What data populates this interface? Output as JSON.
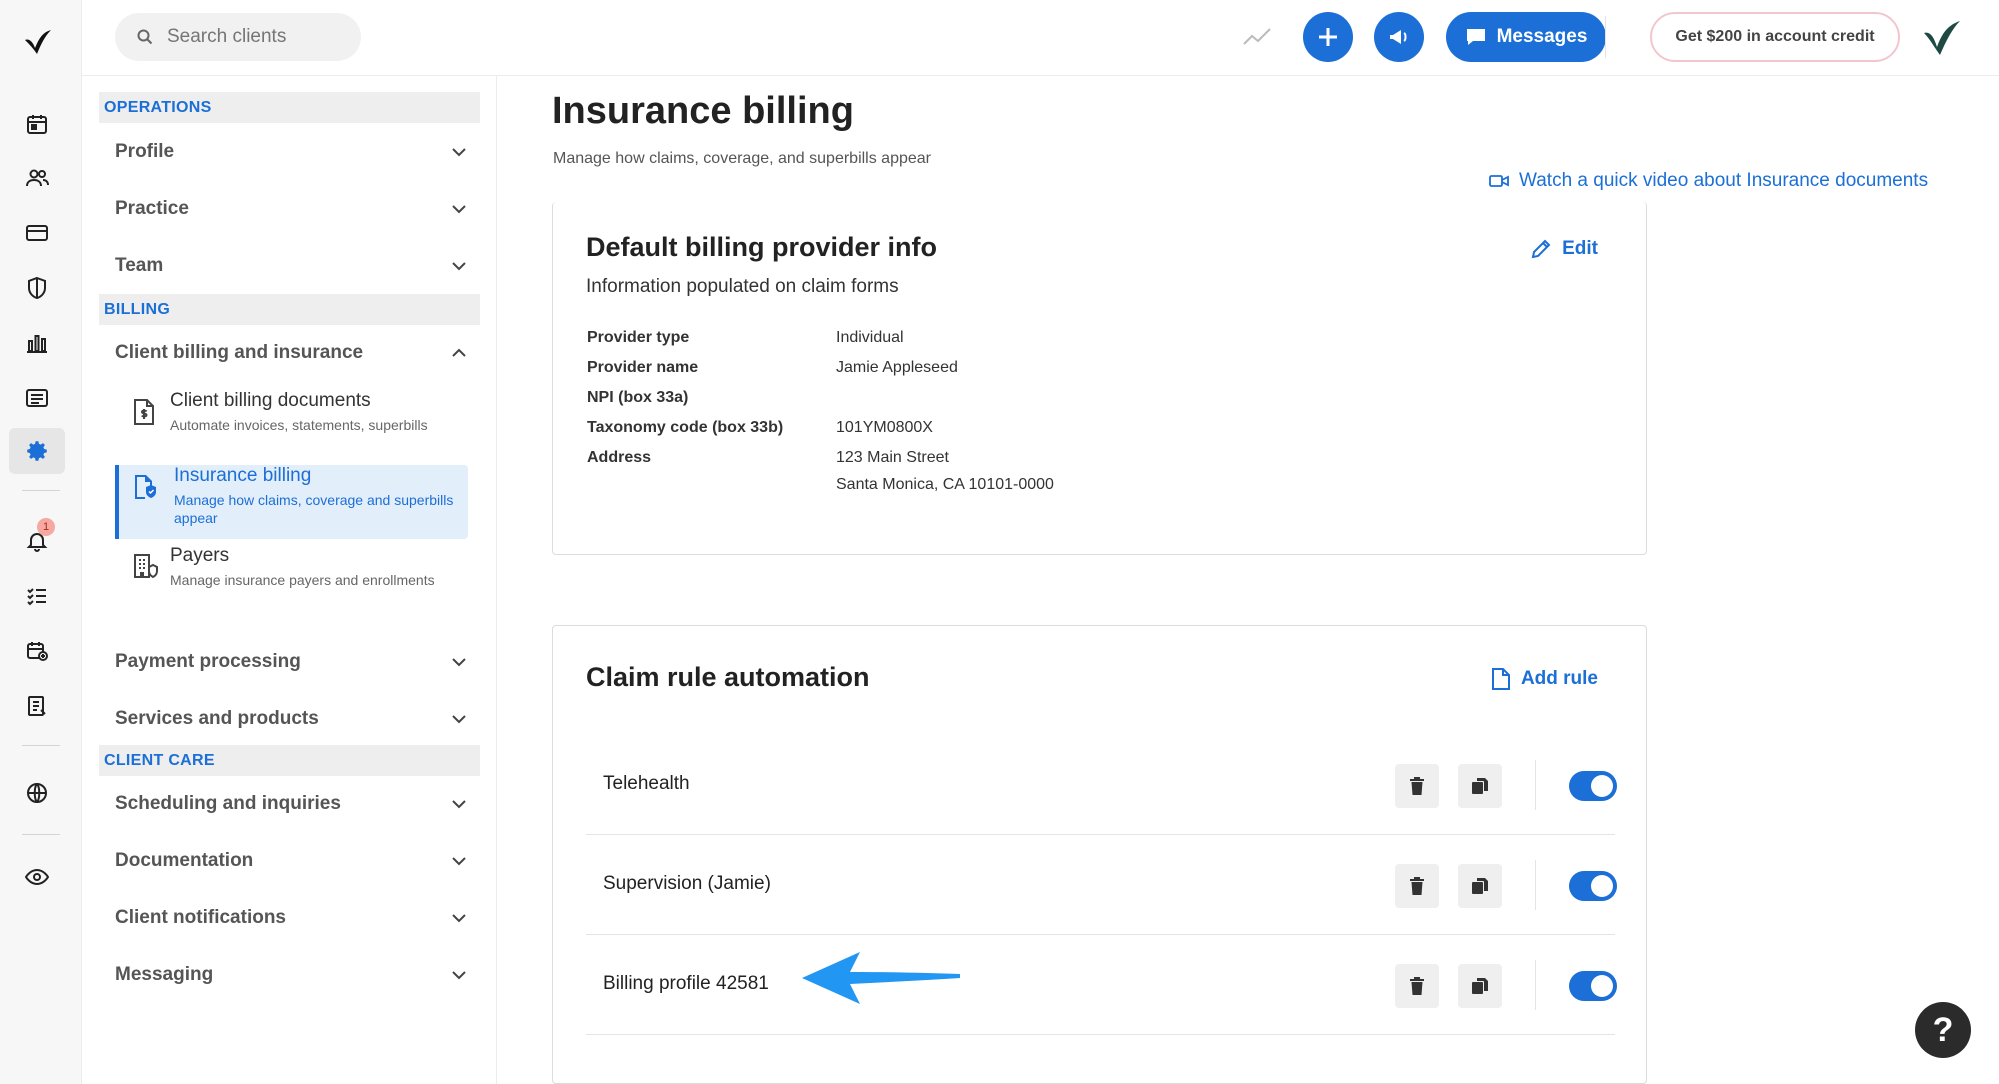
{
  "search": {
    "placeholder": "Search clients"
  },
  "topbar": {
    "messages_label": "Messages",
    "credit_label": "Get $200 in account credit"
  },
  "rail": {
    "notification_count": "1"
  },
  "sidebar": {
    "operations_header": "OPERATIONS",
    "billing_header": "BILLING",
    "client_care_header": "CLIENT CARE",
    "profile": "Profile",
    "practice": "Practice",
    "team": "Team",
    "client_billing_and_insurance": "Client billing and insurance",
    "sub_items": [
      {
        "title": "Client billing documents",
        "desc": "Automate invoices, statements, superbills"
      },
      {
        "title": "Insurance billing",
        "desc": "Manage how claims, coverage and superbills appear"
      },
      {
        "title": "Payers",
        "desc": "Manage insurance payers and enrollments"
      }
    ],
    "payment_processing": "Payment processing",
    "services_and_products": "Services and products",
    "scheduling_and_inquiries": "Scheduling and inquiries",
    "documentation": "Documentation",
    "client_notifications": "Client notifications",
    "messaging": "Messaging"
  },
  "main": {
    "title": "Insurance billing",
    "subtitle": "Manage how claims, coverage, and superbills appear",
    "video_link": "Watch a quick video about Insurance documents",
    "provider_card": {
      "title": "Default billing provider info",
      "desc": "Information populated on claim forms",
      "edit_label": "Edit",
      "rows": [
        {
          "key": "Provider type",
          "value": "Individual"
        },
        {
          "key": "Provider name",
          "value": "Jamie Appleseed"
        },
        {
          "key": "NPI (box 33a)",
          "value": ""
        },
        {
          "key": "Taxonomy code (box 33b)",
          "value": "101YM0800X"
        },
        {
          "key": "Address",
          "value": "123 Main Street",
          "value2": "Santa Monica, CA 10101-0000"
        }
      ]
    },
    "claim_card": {
      "title": "Claim rule automation",
      "add_rule_label": "Add rule",
      "rules": [
        {
          "name": "Telehealth",
          "enabled": true
        },
        {
          "name": "Supervision (Jamie)",
          "enabled": true
        },
        {
          "name": "Billing profile 42581",
          "enabled": true
        }
      ]
    }
  },
  "help_label": "?",
  "colors": {
    "accent": "#1b6fd6",
    "arrow": "#2196f3"
  }
}
